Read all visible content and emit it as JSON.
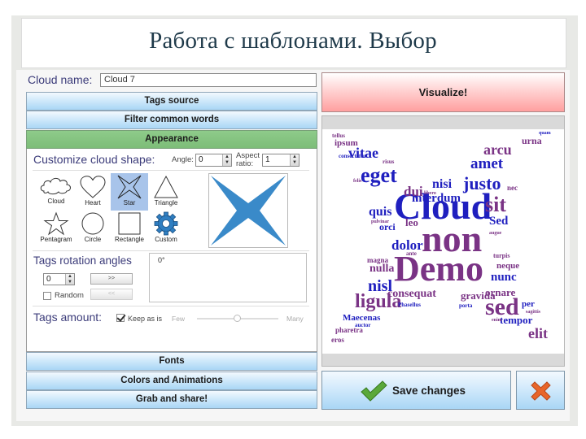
{
  "slide": {
    "title": "Работа с шаблонами. Выбор"
  },
  "left_panel": {
    "cloud_name_label": "Cloud name:",
    "cloud_name_value": "Cloud 7",
    "sections": {
      "tags_source": "Tags source",
      "filter_common_words": "Filter common words",
      "appearance": "Appearance",
      "fonts": "Fonts",
      "colors_and_animations": "Colors and Animations",
      "grab_and_share": "Grab and share!"
    },
    "appearance": {
      "customize_title": "Customize cloud shape:",
      "angle_label": "Angle:",
      "angle_value": "0",
      "aspect_label_1": "Aspect",
      "aspect_label_2": "ratio:",
      "aspect_value": "1",
      "shapes": [
        {
          "name": "Cloud",
          "icon": "cloud-icon",
          "selected": false
        },
        {
          "name": "Heart",
          "icon": "heart-icon",
          "selected": false
        },
        {
          "name": "Star",
          "icon": "star-icon",
          "selected": true
        },
        {
          "name": "Triangle",
          "icon": "triangle-icon",
          "selected": false
        },
        {
          "name": "Pentagram",
          "icon": "pentagram-icon",
          "selected": false
        },
        {
          "name": "Circle",
          "icon": "circle-icon",
          "selected": false
        },
        {
          "name": "Rectangle",
          "icon": "rectangle-icon",
          "selected": false
        },
        {
          "name": "Custom",
          "icon": "gear-icon",
          "selected": false
        }
      ],
      "preview_color": "#3a8ac9",
      "rotation_title": "Tags rotation angles",
      "rotation_value": "0",
      "add_label": ">>",
      "remove_label": "<<",
      "random_label": "Random",
      "random_checked": false,
      "rotation_list": [
        "0°"
      ],
      "amount_title": "Tags amount:",
      "keep_as_is_label": "Keep as is",
      "keep_as_is_checked": true,
      "few_label": "Few",
      "many_label": "Many",
      "amount_slider_fraction": 0.5
    }
  },
  "right_panel": {
    "visualize_label": "Visualize!",
    "save_label": "Save changes",
    "colors": {
      "blue": "#1f1fbf",
      "purple": "#7a3385"
    },
    "words": [
      {
        "t": "Cloud",
        "c": "blue",
        "s": 46
      },
      {
        "t": "non",
        "c": "purple",
        "s": 46
      },
      {
        "t": "Demo",
        "c": "purple",
        "s": 44
      },
      {
        "t": "eget",
        "c": "blue",
        "s": 26
      },
      {
        "t": "vitae",
        "c": "blue",
        "s": 18
      },
      {
        "t": "justo",
        "c": "blue",
        "s": 22
      },
      {
        "t": "amet",
        "c": "blue",
        "s": 19
      },
      {
        "t": "arcu",
        "c": "purple",
        "s": 18
      },
      {
        "t": "urna",
        "c": "purple",
        "s": 12
      },
      {
        "t": "sit",
        "c": "purple",
        "s": 26
      },
      {
        "t": "nisi",
        "c": "blue",
        "s": 16
      },
      {
        "t": "interdum",
        "c": "blue",
        "s": 15
      },
      {
        "t": "dui",
        "c": "purple",
        "s": 17
      },
      {
        "t": "quis",
        "c": "blue",
        "s": 16
      },
      {
        "t": "orci",
        "c": "blue",
        "s": 12
      },
      {
        "t": "leo",
        "c": "purple",
        "s": 13
      },
      {
        "t": "Sed",
        "c": "blue",
        "s": 15
      },
      {
        "t": "dolor",
        "c": "blue",
        "s": 17
      },
      {
        "t": "nisl",
        "c": "blue",
        "s": 20
      },
      {
        "t": "nulla",
        "c": "purple",
        "s": 14
      },
      {
        "t": "ligula",
        "c": "purple",
        "s": 24
      },
      {
        "t": "consequat",
        "c": "purple",
        "s": 14
      },
      {
        "t": "Maecenas",
        "c": "blue",
        "s": 11
      },
      {
        "t": "pharetra",
        "c": "purple",
        "s": 9
      },
      {
        "t": "eros",
        "c": "purple",
        "s": 9
      },
      {
        "t": "nunc",
        "c": "blue",
        "s": 15
      },
      {
        "t": "ornare",
        "c": "purple",
        "s": 13
      },
      {
        "t": "gravida",
        "c": "purple",
        "s": 13
      },
      {
        "t": "sed",
        "c": "purple",
        "s": 30
      },
      {
        "t": "per",
        "c": "blue",
        "s": 11
      },
      {
        "t": "tempor",
        "c": "blue",
        "s": 13
      },
      {
        "t": "elit",
        "c": "purple",
        "s": 18
      },
      {
        "t": "neque",
        "c": "purple",
        "s": 11
      },
      {
        "t": "turpis",
        "c": "purple",
        "s": 8
      },
      {
        "t": "magna",
        "c": "purple",
        "s": 9
      },
      {
        "t": "ipsum",
        "c": "purple",
        "s": 11
      },
      {
        "t": "consectetur",
        "c": "blue",
        "s": 7
      },
      {
        "t": "tellus",
        "c": "purple",
        "s": 7
      },
      {
        "t": "risus",
        "c": "purple",
        "s": 7
      },
      {
        "t": "ante",
        "c": "purple",
        "s": 7
      },
      {
        "t": "nec",
        "c": "purple",
        "s": 9
      },
      {
        "t": "porta",
        "c": "blue",
        "s": 7
      },
      {
        "t": "Phasellus",
        "c": "blue",
        "s": 7
      },
      {
        "t": "auctor",
        "c": "blue",
        "s": 7
      },
      {
        "t": "quam",
        "c": "blue",
        "s": 6
      },
      {
        "t": "pulvinar",
        "c": "purple",
        "s": 6
      },
      {
        "t": "augue",
        "c": "purple",
        "s": 6
      },
      {
        "t": "sagittis",
        "c": "purple",
        "s": 6
      },
      {
        "t": "enim",
        "c": "purple",
        "s": 6
      },
      {
        "t": "libero",
        "c": "purple",
        "s": 6
      },
      {
        "t": "felis",
        "c": "purple",
        "s": 6
      }
    ]
  }
}
